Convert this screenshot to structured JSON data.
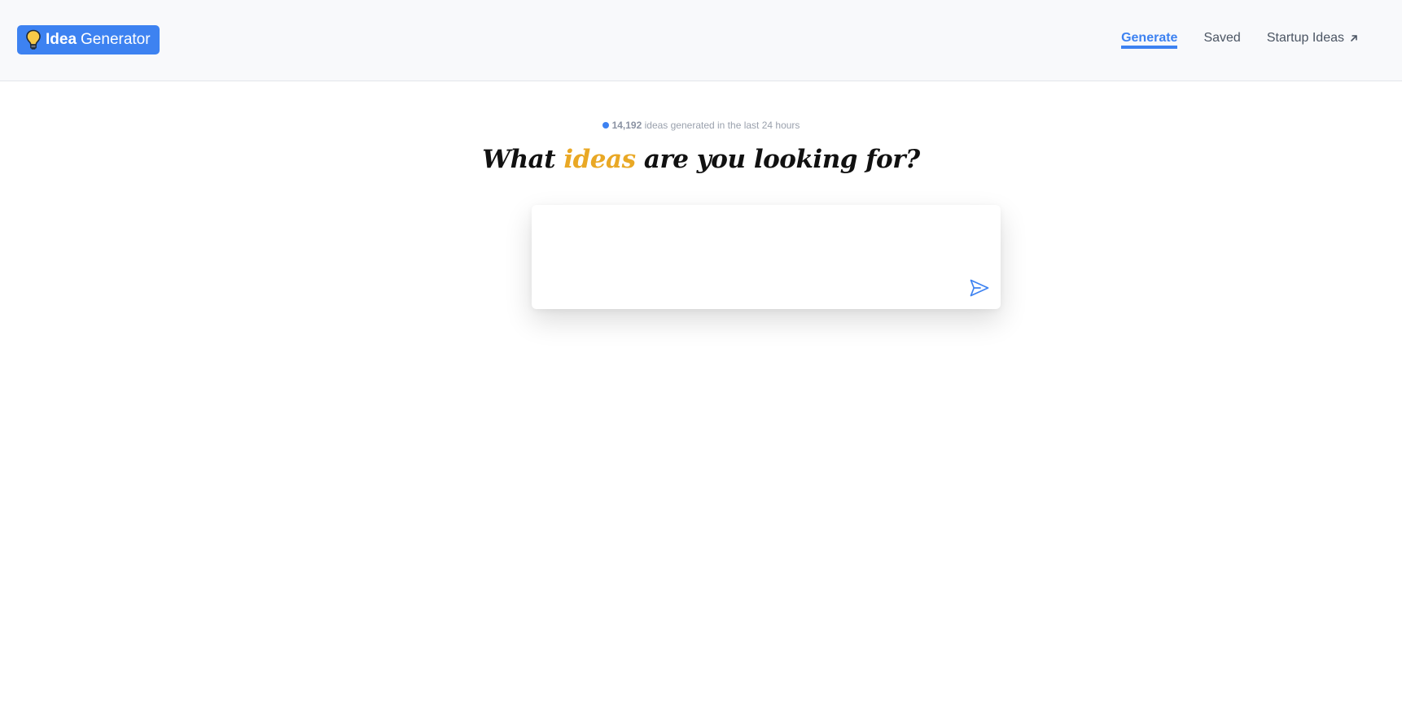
{
  "brand": {
    "name_bold": "Idea",
    "name_rest": "Generator",
    "color": "#3d82f1",
    "icon": "lightbulb-icon"
  },
  "nav": {
    "items": [
      {
        "label": "Generate",
        "active": true
      },
      {
        "label": "Saved",
        "active": false
      },
      {
        "label": "Startup Ideas",
        "active": false,
        "icon": "external-arrow-icon"
      }
    ]
  },
  "stats": {
    "count": "14,192",
    "text": "ideas generated in the last 24 hours"
  },
  "headline": {
    "before": "What",
    "highlight": "ideas",
    "after": "are you looking for?",
    "highlight_color": "#e9a825"
  },
  "prompt": {
    "value": "",
    "placeholder": "",
    "send_icon": "send-icon"
  }
}
